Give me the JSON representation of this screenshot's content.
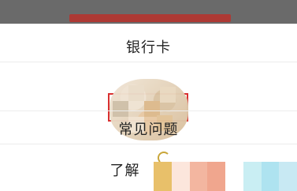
{
  "sheet": {
    "options": [
      {
        "id": "bank-card",
        "label": "银行卡"
      },
      {
        "id": "faq",
        "label": "常见问题"
      },
      {
        "id": "learn-more",
        "label": "了解"
      }
    ]
  },
  "colors": {
    "highlight_border": "#d93030",
    "backdrop": "#6a6a6a",
    "divider": "#ececec"
  }
}
